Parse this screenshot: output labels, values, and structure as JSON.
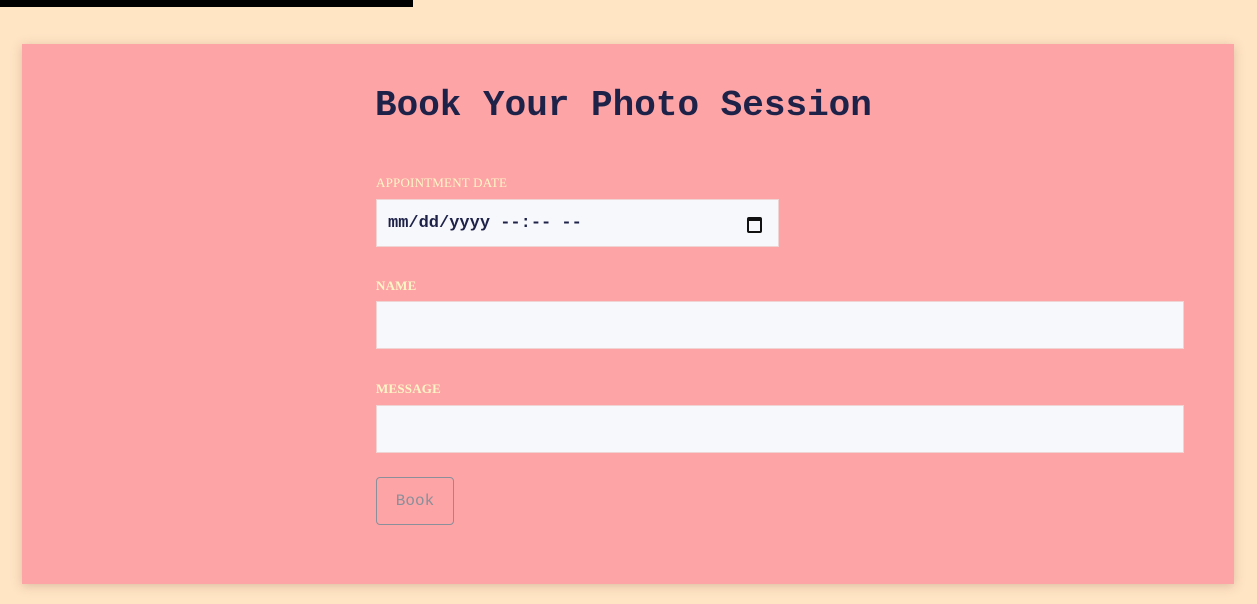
{
  "form": {
    "title": "Book Your Photo Session",
    "date": {
      "label": "APPOINTMENT DATE",
      "placeholder": "mm/dd/yyyy --:-- --",
      "icon": "calendar-icon"
    },
    "name": {
      "label": "NAME",
      "value": ""
    },
    "message": {
      "label": "MESSAGE",
      "value": ""
    },
    "submit_label": "Book"
  },
  "colors": {
    "page_background": "#ffe5c4",
    "card_background": "#fca4a6",
    "title": "#1e2249",
    "label": "#fff6c5",
    "input_background": "#f7f8fb",
    "button_outline": "#8a8f9a"
  }
}
